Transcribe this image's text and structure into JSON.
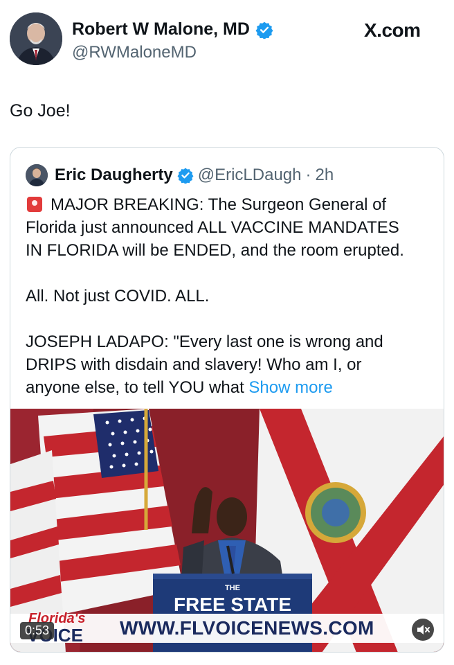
{
  "header": {
    "display_name": "Robert W Malone, MD",
    "handle": "@RWMaloneMD",
    "source": "X.com"
  },
  "tweet": {
    "text": "Go Joe!"
  },
  "quote": {
    "display_name": "Eric Daugherty",
    "handle": "@EricLDaugh",
    "separator": "·",
    "time": "2h",
    "icon": "siren-emoji",
    "lines": [
      "MAJOR BREAKING: The Surgeon General of",
      "Florida just announced ALL VACCINE MANDATES",
      "IN FLORIDA will be ENDED, and the room erupted.",
      "All. Not just COVID. ALL.",
      "JOSEPH LADAPO: \"Every last one is wrong and",
      "DRIPS with disdain and slavery! Who am I, or",
      "anyone else, to tell YOU what "
    ],
    "show_more": "Show more"
  },
  "video": {
    "podium_top": "THE",
    "podium_main": "FREE STATE",
    "logo_line1": "Florida's",
    "logo_line2": "VOICE",
    "url": "WWW.FLVOICENEWS.COM",
    "timer": "0:53",
    "mute_icon": "speaker-muted-icon"
  },
  "colors": {
    "link": "#1d9bf0",
    "verified": "#1d9bf0",
    "secondary_text": "#536471",
    "border": "#cfd9de"
  }
}
